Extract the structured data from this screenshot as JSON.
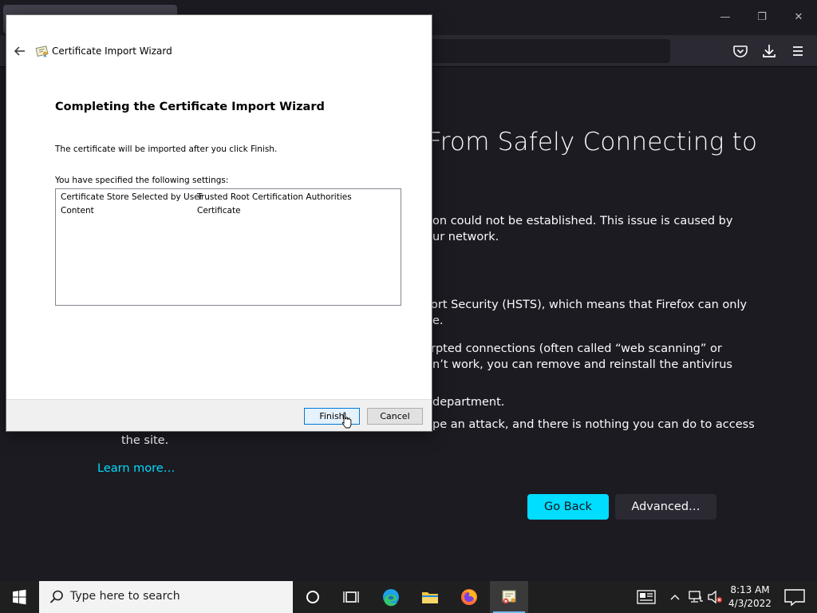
{
  "browser": {
    "error_title": "From Safely Connecting to",
    "lines": [
      "ion could not be established. This issue is caused by",
      "ur network.",
      "ort Security (HSTS), which means that Firefox can only",
      "e.",
      "rpted connections (often called “web scanning” or",
      "n’t work, you can remove and reinstall the antivirus",
      "department.",
      "pe an attack, and there is nothing you can do to access",
      "the site."
    ],
    "learn_more": "Learn more…",
    "go_back": "Go Back",
    "advanced": "Advanced…",
    "window_controls": {
      "minimize": "—",
      "maximize": "❐",
      "close": "✕"
    }
  },
  "dialog": {
    "title": "Certificate Import Wizard",
    "heading": "Completing the Certificate Import Wizard",
    "info": "The certificate will be imported after you click Finish.",
    "settings_label": "You have specified the following settings:",
    "settings": [
      {
        "key": "Certificate Store Selected by User",
        "value": "Trusted Root Certification Authorities"
      },
      {
        "key": "Content",
        "value": "Certificate"
      }
    ],
    "finish": "Finish",
    "cancel": "Cancel"
  },
  "taskbar": {
    "search_placeholder": "Type here to search",
    "time": "8:13 AM",
    "date": "4/3/2022",
    "apps": [
      "cortana-icon",
      "task-view-icon",
      "edge-icon",
      "file-explorer-icon",
      "firefox-icon",
      "certificate-manager-icon"
    ]
  },
  "colors": {
    "accent": "#00ddff",
    "dialog_primary_border": "#0078d7"
  }
}
